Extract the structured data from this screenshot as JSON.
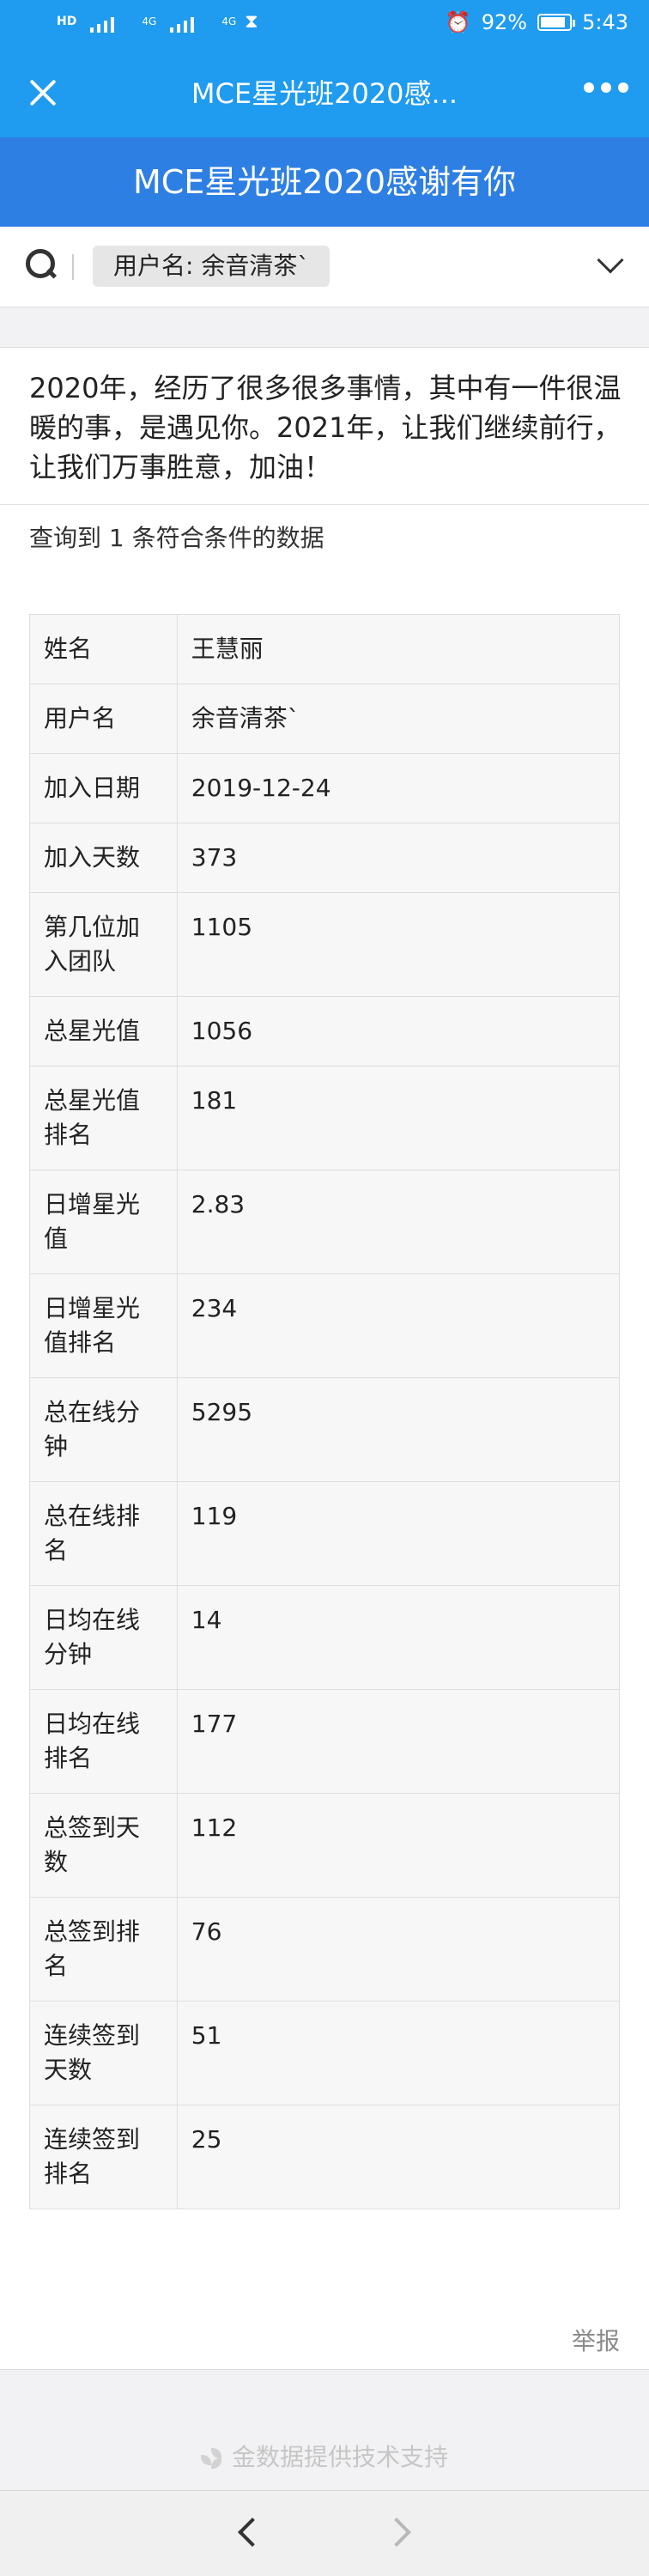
{
  "status_bar": {
    "network_left": "HD",
    "signal_labels": [
      "4G",
      "4G"
    ],
    "battery": "92%",
    "time": "5:43"
  },
  "nav": {
    "title": "MCE星光班2020感..."
  },
  "header": {
    "title": "MCE星光班2020感谢有你"
  },
  "search": {
    "filter_tag": "用户名: 余音清茶`"
  },
  "intro": "2020年，经历了很多很多事情，其中有一件很温暖的事，是遇见你。2021年，让我们继续前行，让我们万事胜意，加油！",
  "result_count": "查询到 1 条符合条件的数据",
  "rows": [
    {
      "label": "姓名",
      "value": "王慧丽"
    },
    {
      "label": "用户名",
      "value": "余音清茶`"
    },
    {
      "label": "加入日期",
      "value": "2019-12-24"
    },
    {
      "label": "加入天数",
      "value": "373"
    },
    {
      "label": "第几位加入团队",
      "value": "1105"
    },
    {
      "label": "总星光值",
      "value": "1056"
    },
    {
      "label": "总星光值排名",
      "value": "181"
    },
    {
      "label": "日增星光值",
      "value": "2.83"
    },
    {
      "label": "日增星光值排名",
      "value": "234"
    },
    {
      "label": "总在线分钟",
      "value": "5295"
    },
    {
      "label": "总在线排名",
      "value": "119"
    },
    {
      "label": "日均在线分钟",
      "value": "14"
    },
    {
      "label": "日均在线排名",
      "value": "177"
    },
    {
      "label": "总签到天数",
      "value": "112"
    },
    {
      "label": "总签到排名",
      "value": "76"
    },
    {
      "label": "连续签到天数",
      "value": "51"
    },
    {
      "label": "连续签到排名",
      "value": "25"
    }
  ],
  "report_label": "举报",
  "footer": "金数据提供技术支持",
  "colors": {
    "nav_blue": "#1f9bf0",
    "header_blue": "#2e7fe3"
  }
}
